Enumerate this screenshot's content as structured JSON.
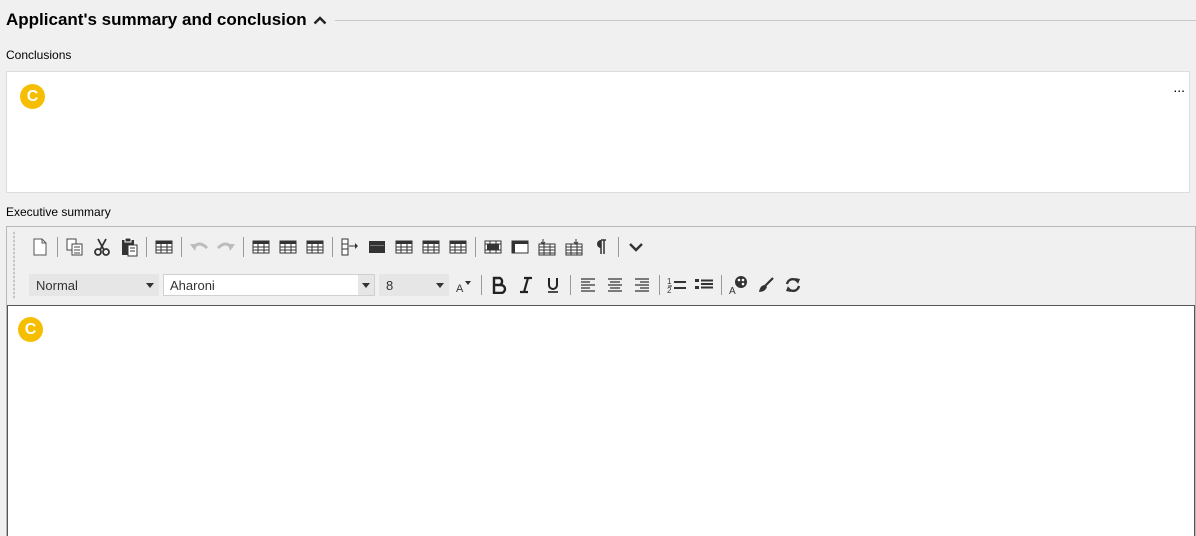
{
  "section": {
    "title": "Applicant's summary and conclusion"
  },
  "conclusions": {
    "label": "Conclusions",
    "badge": "C",
    "more": "..."
  },
  "executive_summary": {
    "label": "Executive summary",
    "badge": "C",
    "style_select": "Normal",
    "font_select": "Aharoni",
    "size_select": "8"
  },
  "colors": {
    "accent": "#f5be00",
    "background": "#f0f0f0",
    "rule": "#c8c8c8"
  },
  "toolbar_icons_row1": [
    "new-document-icon",
    "copy-icon",
    "cut-icon",
    "paste-icon",
    "insert-table-icon",
    "undo-icon",
    "redo-icon",
    "table-style-1-icon",
    "table-style-2-icon",
    "table-style-3-icon",
    "row-align-icon",
    "table-header-icon",
    "table-style-4-icon",
    "table-style-5-icon",
    "table-style-6-icon",
    "merge-cells-icon",
    "split-cells-icon",
    "insert-column-left-icon",
    "insert-column-right-icon",
    "pilcrow-icon",
    "expand-toolbar-icon"
  ],
  "toolbar_icons_row2": [
    "font-size-icon",
    "bold-icon",
    "italic-icon",
    "underline-icon",
    "align-left-icon",
    "align-center-icon",
    "align-right-icon",
    "numbered-list-icon",
    "bulleted-list-icon",
    "text-color-icon",
    "clear-format-icon",
    "refresh-icon"
  ]
}
